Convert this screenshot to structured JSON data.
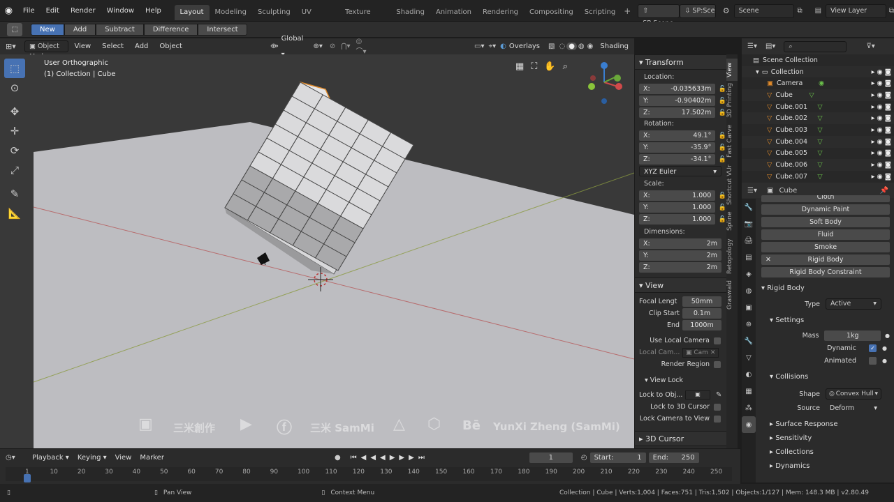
{
  "menus": [
    "File",
    "Edit",
    "Render",
    "Window",
    "Help"
  ],
  "workspaces": [
    "Layout",
    "Modeling",
    "Sculpting",
    "UV Editing",
    "Texture Paint",
    "Shading",
    "Animation",
    "Rendering",
    "Compositing",
    "Scripting"
  ],
  "add_workspace": "+",
  "sp_scene_1": "SP:Scene",
  "sp_scene_2": "SP:Scen",
  "scene_name": "Scene",
  "view_layer": "View Layer",
  "modes": [
    "New",
    "Add",
    "Subtract",
    "Difference",
    "Intersect"
  ],
  "vp_header": {
    "mode": "Object Mode",
    "menus": [
      "View",
      "Select",
      "Add",
      "Object"
    ],
    "orientation": "Global",
    "overlays": "Overlays",
    "shading": "Shading"
  },
  "viewport": {
    "view_name": "User Orthographic",
    "collection": "(1) Collection | Cube"
  },
  "watermark": {
    "a": "三米創作",
    "b": "三米 SamMi",
    "c": "YunXi Zheng (SamMi)",
    "be": "Bē"
  },
  "npanel": {
    "transform": "Transform",
    "location": "Location:",
    "loc": [
      {
        "axis": "X:",
        "val": "-0.035633m"
      },
      {
        "axis": "Y:",
        "val": "-0.90402m"
      },
      {
        "axis": "Z:",
        "val": "17.502m"
      }
    ],
    "rotation": "Rotation:",
    "rot": [
      {
        "axis": "X:",
        "val": "49.1°"
      },
      {
        "axis": "Y:",
        "val": "-35.9°"
      },
      {
        "axis": "Z:",
        "val": "-34.1°"
      }
    ],
    "euler": "XYZ Euler",
    "scale": "Scale:",
    "scl": [
      {
        "axis": "X:",
        "val": "1.000"
      },
      {
        "axis": "Y:",
        "val": "1.000"
      },
      {
        "axis": "Z:",
        "val": "1.000"
      }
    ],
    "dimensions": "Dimensions:",
    "dim": [
      {
        "axis": "X:",
        "val": "2m"
      },
      {
        "axis": "Y:",
        "val": "2m"
      },
      {
        "axis": "Z:",
        "val": "2m"
      }
    ],
    "view": "View",
    "focal_label": "Focal Lengt",
    "focal": "50mm",
    "clip_start_label": "Clip Start",
    "clip_start": "0.1m",
    "end_label": "End",
    "end": "1000m",
    "use_local_camera": "Use Local Camera",
    "local_cam_label": "Local Cam...",
    "local_cam_val": "Cam",
    "render_region": "Render Region",
    "view_lock": "View Lock",
    "lock_to_obj": "Lock to Obj...",
    "lock_to_cursor": "Lock to 3D Cursor",
    "lock_camera": "Lock Camera to View",
    "cursor_3d": "3D Cursor"
  },
  "vtabs": [
    "View",
    "3D Printing",
    "Fast Carve",
    "Shortcut VUr",
    "Spline",
    "Retopology",
    "Graswald"
  ],
  "outliner": {
    "scene_collection": "Scene Collection",
    "collection": "Collection",
    "items": [
      "Camera",
      "Cube",
      "Cube.001",
      "Cube.002",
      "Cube.003",
      "Cube.004",
      "Cube.005",
      "Cube.006",
      "Cube.007"
    ]
  },
  "props": {
    "object_name": "Cube",
    "cloth": "Cloth",
    "physics_buttons": [
      "Dynamic Paint",
      "Soft Body",
      "Fluid",
      "Smoke",
      "Rigid Body",
      "Rigid Body Constraint"
    ],
    "remove": "✕",
    "rigid_body": "Rigid Body",
    "type_label": "Type",
    "type_value": "Active",
    "settings": "Settings",
    "mass_label": "Mass",
    "mass_value": "1kg",
    "dynamic": "Dynamic",
    "animated": "Animated",
    "collisions": "Collisions",
    "shape_label": "Shape",
    "shape_value": "Convex Hull",
    "source_label": "Source",
    "source_value": "Deform",
    "subpanels": [
      "Surface Response",
      "Sensitivity",
      "Collections",
      "Dynamics"
    ]
  },
  "timeline": {
    "menus": [
      "Playback",
      "Keying",
      "View",
      "Marker"
    ],
    "current_frame": "1",
    "start_label": "Start:",
    "start": "1",
    "end_label": "End:",
    "end": "250",
    "ticks": [
      "1",
      "10",
      "20",
      "30",
      "40",
      "50",
      "60",
      "70",
      "80",
      "90",
      "100",
      "110",
      "120",
      "130",
      "140",
      "150",
      "160",
      "170",
      "180",
      "190",
      "200",
      "210",
      "220",
      "230",
      "240",
      "250"
    ]
  },
  "status": {
    "pan": "Pan View",
    "context": "Context Menu",
    "stats": "Collection | Cube | Verts:1,004 | Faces:751 | Tris:1,502 | Objects:1/127 | Mem: 148.3 MB | v2.80.49"
  }
}
